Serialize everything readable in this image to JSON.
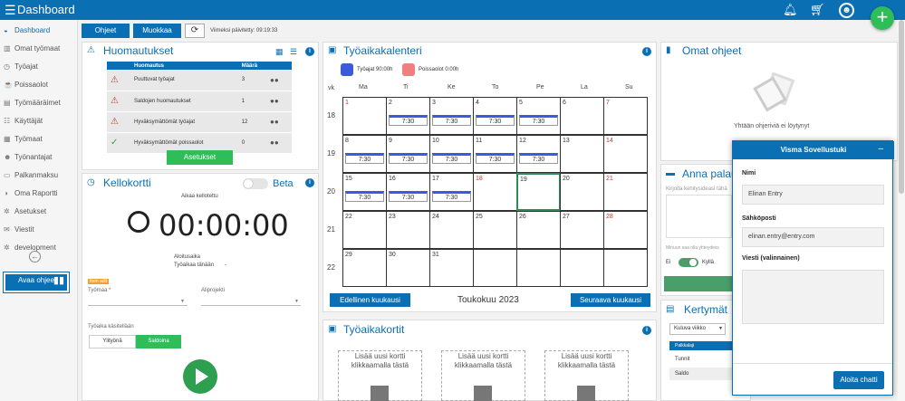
{
  "app": {
    "title": "Dashboard"
  },
  "sidebar": {
    "items": [
      {
        "label": "Dashboard",
        "icon": "dashboard-icon",
        "glyph": "◒",
        "active": true
      },
      {
        "label": "Omat työmaat",
        "icon": "sites-icon",
        "glyph": "▥"
      },
      {
        "label": "Työajat",
        "icon": "stopwatch-icon",
        "glyph": "◷"
      },
      {
        "label": "Poissaolot",
        "icon": "coffee-icon",
        "glyph": "☕"
      },
      {
        "label": "Työmääräimet",
        "icon": "work-order-icon",
        "glyph": "▤"
      },
      {
        "label": "Käyttäjät",
        "icon": "users-icon",
        "glyph": "☷"
      },
      {
        "label": "Työmaat",
        "icon": "worksite-icon",
        "glyph": "▦"
      },
      {
        "label": "Työnantajat",
        "icon": "employer-icon",
        "glyph": "☻"
      },
      {
        "label": "Palkanmaksu",
        "icon": "payroll-icon",
        "glyph": "▭"
      },
      {
        "label": "Oma Raportti",
        "icon": "report-icon",
        "glyph": "◑"
      },
      {
        "label": "Asetukset",
        "icon": "settings-icon",
        "glyph": "✲"
      },
      {
        "label": "Viestit",
        "icon": "mail-icon",
        "glyph": "✉"
      },
      {
        "label": "development",
        "icon": "gear-icon",
        "glyph": "✲"
      }
    ],
    "open_guides": "Avaa ohjeet"
  },
  "toolbar": {
    "ohjeet": "Ohjeet",
    "muokkaa": "Muokkaa",
    "last_updated": "Viimeksi päivitetty: 09:19:33"
  },
  "notices": {
    "title": "Huomautukset",
    "col_notice": "Huomautus",
    "col_count": "Määrä",
    "rows": [
      {
        "label": "Puuttuvat työajat",
        "count": "3",
        "icon": "warning-icon"
      },
      {
        "label": "Saldojen huomautukset",
        "count": "1",
        "icon": "warning-icon"
      },
      {
        "label": "Hyväksymättömät työajat",
        "count": "12",
        "icon": "warning-icon"
      },
      {
        "label": "Hyväksymättömät poissaolot",
        "count": "0",
        "icon": "check-icon"
      }
    ],
    "settings": "Asetukset"
  },
  "timeclock": {
    "title": "Kellokortti",
    "beta": "Beta",
    "time_label": "Aikaa kellotettu",
    "time": "00:00:00",
    "start_time": "Aloitusaika",
    "worktime_today": "Työaikaa tänään",
    "worktime_value": "-",
    "tag": "Item add",
    "worksite": "Työmaa *",
    "subproject": "Aliprojekti",
    "handling": "Työaika käsitellään",
    "overtime": "Ylityönä",
    "balance": "Saldoina"
  },
  "calendar": {
    "title": "Työaikakalenteri",
    "legend_work": "Työajat 90:00h",
    "legend_absence": "Poissaolot 0:00h",
    "color_work": "#3b5bdb",
    "color_absence": "#f08080",
    "vk": "vk",
    "days": [
      "Ma",
      "Ti",
      "Ke",
      "To",
      "Pe",
      "La",
      "Su"
    ],
    "weeks": [
      "18",
      "19",
      "20",
      "21",
      "22"
    ],
    "cells": [
      [
        "1",
        "2",
        "3",
        "4",
        "5",
        "6",
        "7"
      ],
      [
        "8",
        "9",
        "10",
        "11",
        "12",
        "13",
        "14"
      ],
      [
        "15",
        "16",
        "17",
        "18",
        "19",
        "20",
        "21"
      ],
      [
        "22",
        "23",
        "24",
        "25",
        "26",
        "27",
        "28"
      ],
      [
        "29",
        "30",
        "31",
        "",
        "",
        "",
        ""
      ]
    ],
    "chip": "7:30",
    "prev": "Edellinen kuukausi",
    "month": "Toukokuu 2023",
    "next": "Seuraava kuukausi"
  },
  "cards": {
    "title": "Työaikakortit",
    "add": "Lisää uusi kortti klikkaamalla tästä"
  },
  "guides": {
    "title": "Omat ohjeet",
    "empty": "Yhtään ohjeriviä ei löytynyt"
  },
  "feedback": {
    "title": "Anna palau",
    "hint": "Kirjoita kehitysideasi tähä",
    "contact": "Minuun saa olla yhteydess",
    "no": "Ei",
    "yes": "Kyllä"
  },
  "accrual": {
    "title": "Kertymät",
    "select": "Kuluva viikko",
    "col": "Palkkalaji",
    "hours": "Tunnit",
    "balance": "Saldo"
  },
  "support": {
    "title": "Visma Sovellustuki",
    "name_label": "Nimi",
    "name_value": "Elinan Entry",
    "email_label": "Sähköposti",
    "email_value": "elinan.entry@entry.com",
    "message_label": "Viesti (valinnainen)",
    "start_chat": "Aloita chatti"
  }
}
